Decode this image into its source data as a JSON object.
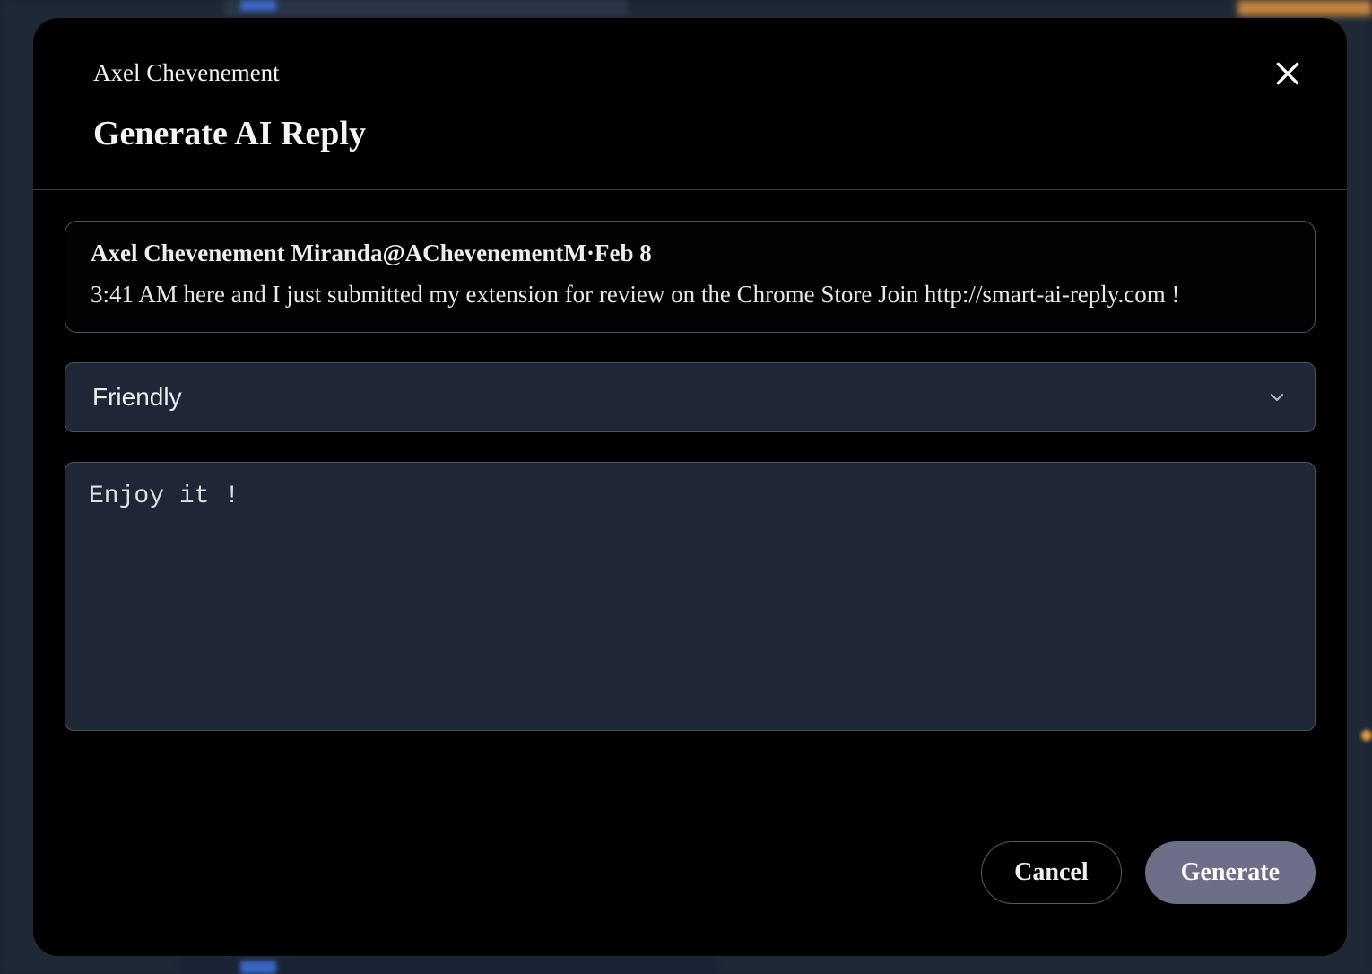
{
  "header": {
    "author": "Axel Chevenement",
    "title": "Generate AI Reply"
  },
  "post": {
    "author_name": "Axel Chevenement Miranda",
    "author_handle": "@AChevenementM",
    "separator": "·",
    "date": "Feb 8",
    "content": "3:41 AM here and I just submitted my extension for review on the Chrome Store Join http://smart-ai-reply.com !"
  },
  "tone": {
    "selected": "Friendly"
  },
  "reply": {
    "value": "Enjoy it !"
  },
  "footer": {
    "cancel_label": "Cancel",
    "generate_label": "Generate"
  },
  "icons": {
    "close": "close-icon",
    "chevron": "chevron-down-icon"
  }
}
